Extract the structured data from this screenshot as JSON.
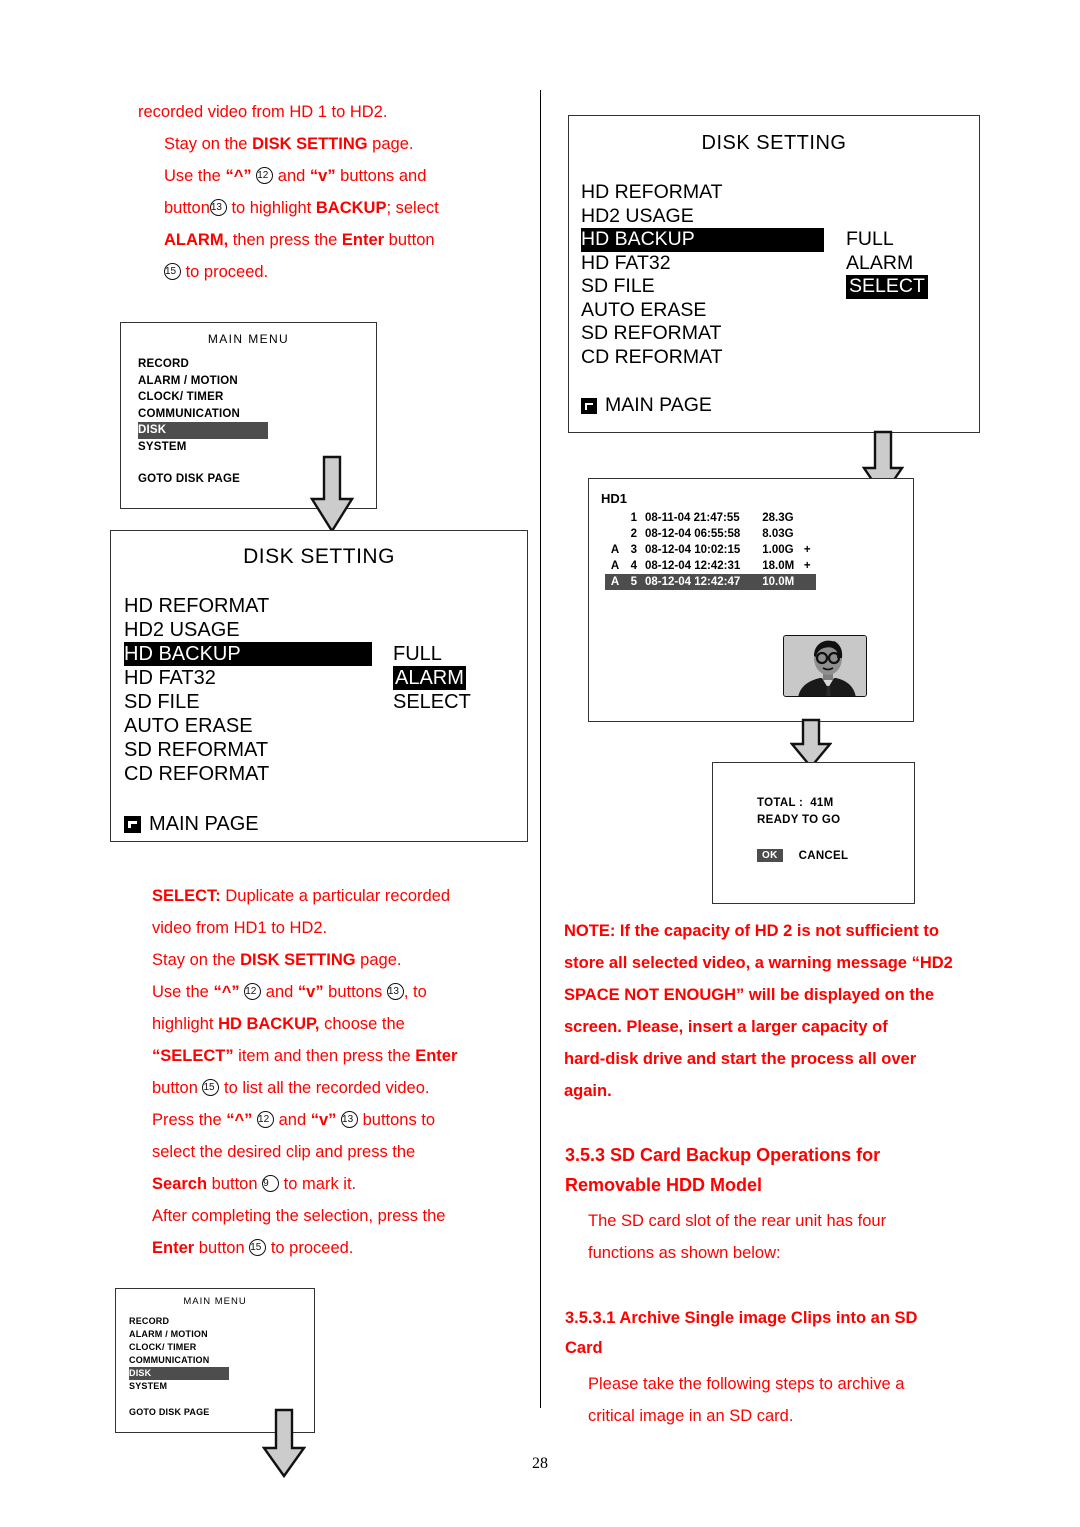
{
  "page": {
    "number": "28"
  },
  "left_column": {
    "intro_paragraph": {
      "lines": [
        "recorded video from HD 1 to HD2."
      ]
    },
    "steps_block1": {
      "line1_a": "Stay on the ",
      "line1_b": "DISK SETTING",
      "line1_c": " page.",
      "line2_a": "Use the ",
      "line2_quote": "“^”",
      "line2_badge1": "12",
      "line2_b": " and ",
      "line2_quote2": "“v”",
      "line2_c": " buttons and",
      "line3_a": "button",
      "line3_badge": "13",
      "line3_b": " to highlight ",
      "line3_c": "BACKUP",
      "line3_d": "; select",
      "line4_a": "ALARM,",
      "line4_b": " then press the ",
      "line4_c": "Enter",
      "line4_d": " button",
      "line5_badge": "15",
      "line5_a": " to proceed."
    },
    "main_menu_box": {
      "title": "MAIN  MENU",
      "items": [
        "RECORD",
        "ALARM / MOTION",
        "CLOCK/ TIMER",
        "COMMUNICATION",
        "DISK",
        "SYSTEM"
      ],
      "selected_index": 4,
      "footer": "GOTO DISK PAGE"
    },
    "disk_setting_box": {
      "title": "DISK SETTING",
      "items": [
        "HD REFORMAT",
        "HD2 USAGE",
        "HD BACKUP",
        "HD FAT32",
        "SD FILE",
        "AUTO ERASE",
        "SD REFORMAT",
        "CD REFORMAT"
      ],
      "highlighted_item": "HD BACKUP",
      "options": [
        "FULL",
        "ALARM",
        "SELECT"
      ],
      "highlighted_option": "ALARM",
      "main_page_label": "MAIN PAGE"
    },
    "steps_block2": {
      "l1_a": "SELECT:",
      "l1_b": " Duplicate a particular recorded",
      "l2": "video from HD1 to HD2.",
      "l3_a": "Stay on the ",
      "l3_b": "DISK SETTING",
      "l3_c": " page.",
      "l4_a": "Use the ",
      "l4_q1": "“^”",
      "l4_badge1": "12",
      "l4_b": " and ",
      "l4_q2": "“v”",
      "l4_c": " buttons ",
      "l4_badge2": "13",
      "l4_d": ", to",
      "l5_a": "highlight ",
      "l5_b": "HD BACKUP,",
      "l5_c": " choose the",
      "l6_a": "“SELECT”",
      "l6_b": " item and then press the ",
      "l6_c": "Enter",
      "l7_a": "button ",
      "l7_badge": "15",
      "l7_b": " to list all the recorded video.",
      "l8_a": "Press the ",
      "l8_q1": "“^”",
      "l8_badge1": "12",
      "l8_b": " and ",
      "l8_q2": "“v”",
      "l8_badge2": "13",
      "l8_c": " buttons to",
      "l9": "select the desired clip and press the",
      "l10_a": "Search",
      "l10_b": " button ",
      "l10_badge": "9",
      "l10_c": " to mark it.",
      "l11": "After completing the selection, press the",
      "l12_a": "Enter",
      "l12_b": " button ",
      "l12_badge": "15",
      "l12_c": " to proceed."
    },
    "main_menu_box2": {
      "title": "MAIN  MENU",
      "items": [
        "RECORD",
        "ALARM / MOTION",
        "CLOCK/ TIMER",
        "COMMUNICATION",
        "DISK",
        "SYSTEM"
      ],
      "selected_index": 4,
      "footer": "GOTO DISK PAGE"
    }
  },
  "right_column": {
    "disk_setting_box": {
      "title": "DISK SETTING",
      "items": [
        "HD REFORMAT",
        "HD2 USAGE",
        "HD BACKUP",
        "HD FAT32",
        "SD FILE",
        "AUTO ERASE",
        "SD REFORMAT",
        "CD REFORMAT"
      ],
      "highlighted_item": "HD BACKUP",
      "options": [
        "FULL",
        "ALARM",
        "SELECT"
      ],
      "highlighted_option": "SELECT",
      "main_page_label": "MAIN PAGE"
    },
    "hd_list_box": {
      "title": "HD1",
      "rows": [
        {
          "flag": "",
          "index": "1",
          "datetime": "08-11-04 21:47:55",
          "size": "28.3G",
          "plus": "",
          "selected": false
        },
        {
          "flag": "",
          "index": "2",
          "datetime": "08-12-04 06:55:58",
          "size": "8.03G",
          "plus": "",
          "selected": false
        },
        {
          "flag": "A",
          "index": "3",
          "datetime": "08-12-04 10:02:15",
          "size": "1.00G",
          "plus": "+",
          "selected": false
        },
        {
          "flag": "A",
          "index": "4",
          "datetime": "08-12-04 12:42:31",
          "size": "18.0M",
          "plus": "+",
          "selected": false
        },
        {
          "flag": "A",
          "index": "5",
          "datetime": "08-12-04 12:42:47",
          "size": "10.0M",
          "plus": "",
          "selected": true
        }
      ]
    },
    "confirm_dialog": {
      "total_label": "TOTAL :",
      "total_value": "41M",
      "status": "READY  TO  GO",
      "ok_label": "OK",
      "cancel_label": "CANCEL"
    },
    "note": {
      "l1_a": "NOTE: If the capacity of HD 2 is not sufficient to",
      "l2": "store all selected video, a warning message “HD2",
      "l3": "SPACE NOT ENOUGH” will be displayed on the",
      "l4": "screen. Please, insert a larger capacity of",
      "l5": "hard-disk drive and start the process all over",
      "l6": "again."
    },
    "section_353": {
      "heading_line1": "3.5.3 SD Card Backup Operations for",
      "heading_line2": "Removable HDD Model",
      "body_line1": "The SD card slot of the rear unit has four",
      "body_line2": "functions as shown below:"
    },
    "section_3531": {
      "heading_line1": "3.5.3.1 Archive Single image Clips into an SD",
      "heading_line2": "Card",
      "body_line1": "Please take the following steps to archive a",
      "body_line2": "critical image in an SD card."
    }
  },
  "colors": {
    "instruction_red": "#ff0000",
    "osd_border": "#333333",
    "osd_highlight": "#000000",
    "osd_soft_highlight": "#4d4d4d",
    "arrow_fill": "#cccccc"
  }
}
